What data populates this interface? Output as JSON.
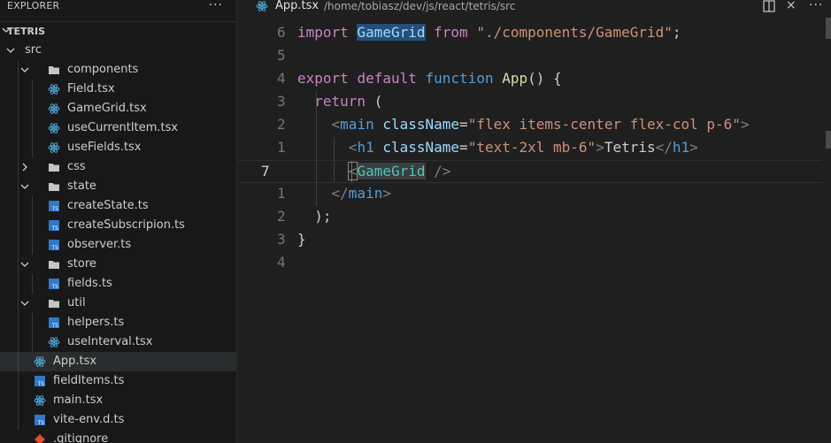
{
  "sidebar": {
    "title": "EXPLORER",
    "more": "···",
    "section": "TETRIS",
    "tree": [
      {
        "name": "src",
        "type": "folder",
        "open": true
      },
      {
        "name": "components",
        "type": "folder",
        "open": true
      },
      {
        "name": "Field.tsx",
        "type": "react"
      },
      {
        "name": "GameGrid.tsx",
        "type": "react"
      },
      {
        "name": "useCurrentItem.tsx",
        "type": "react"
      },
      {
        "name": "useFields.tsx",
        "type": "react"
      },
      {
        "name": "css",
        "type": "folder",
        "open": false
      },
      {
        "name": "state",
        "type": "folder",
        "open": true
      },
      {
        "name": "createState.ts",
        "type": "ts"
      },
      {
        "name": "createSubscripion.ts",
        "type": "ts"
      },
      {
        "name": "observer.ts",
        "type": "ts"
      },
      {
        "name": "store",
        "type": "folder",
        "open": true
      },
      {
        "name": "fields.ts",
        "type": "ts"
      },
      {
        "name": "util",
        "type": "folder",
        "open": true
      },
      {
        "name": "helpers.ts",
        "type": "ts"
      },
      {
        "name": "useInterval.tsx",
        "type": "react"
      },
      {
        "name": "App.tsx",
        "type": "react",
        "active": true
      },
      {
        "name": "fieldItems.ts",
        "type": "ts"
      },
      {
        "name": "main.tsx",
        "type": "react"
      },
      {
        "name": "vite-env.d.ts",
        "type": "ts"
      },
      {
        "name": ".gitignore",
        "type": "git"
      }
    ],
    "ts_badge": "TS"
  },
  "editor": {
    "file": "App.tsx",
    "path": "/home/tobiasz/dev/js/react/tetris/src",
    "actions": {
      "split": "split-editor-icon",
      "close": "×",
      "more": "···"
    },
    "line_numbers": [
      "6",
      "5",
      "4",
      "3",
      "2",
      "1",
      "7",
      "1",
      "2",
      "3",
      "4"
    ],
    "code": {
      "l1": {
        "kw": "import",
        "id": "GameGrid",
        "kw2": "from",
        "str": "\"./components/GameGrid\"",
        "end": ";"
      },
      "l3": {
        "kw1": "export",
        "kw2": "default",
        "kw3": "function",
        "fn": "App",
        "end": "() {"
      },
      "l4": {
        "kw": "return",
        "end": "("
      },
      "l5": {
        "open": "<",
        "tag": "main",
        "attr": "className",
        "eq": "=",
        "str": "\"flex items-center flex-col p-6\"",
        "close": ">"
      },
      "l6": {
        "open": "<",
        "tag": "h1",
        "attr": "className",
        "eq": "=",
        "str": "\"text-2xl mb-6\"",
        "gt": ">",
        "text": "Tetris",
        "end_tag": "</",
        "tag2": "h1",
        "close": ">"
      },
      "l7": {
        "open": "<",
        "comp": "GameGrid",
        "close": " />"
      },
      "l8": {
        "open": "</",
        "tag": "main",
        "close": ">"
      },
      "l9": {
        "text": ");"
      },
      "l10": {
        "text": "}"
      }
    }
  }
}
